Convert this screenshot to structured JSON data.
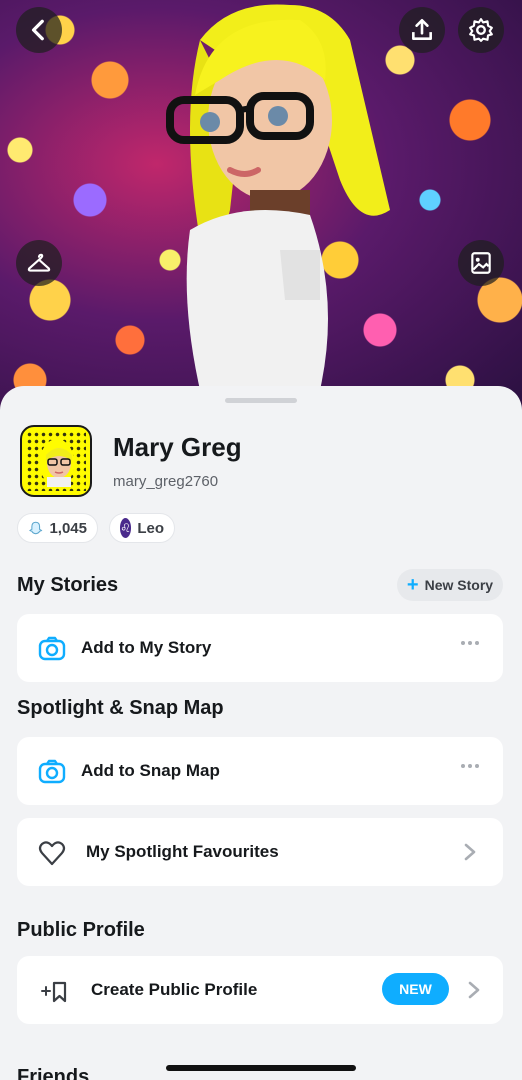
{
  "hero": {
    "back_icon": "chevron-left-icon",
    "share_icon": "upload-icon",
    "settings_icon": "gear-icon",
    "outfit_icon": "hanger-icon",
    "background_icon": "image-icon"
  },
  "profile": {
    "display_name": "Mary Greg",
    "username": "mary_greg2760",
    "score": "1,045",
    "zodiac_symbol": "♌",
    "zodiac": "Leo"
  },
  "my_stories": {
    "title": "My Stories",
    "new_story_label": "New Story",
    "add_label": "Add to My Story"
  },
  "spotlight": {
    "title": "Spotlight & Snap Map",
    "add_snap_map_label": "Add to Snap Map",
    "favourites_label": "My Spotlight Favourites"
  },
  "public_profile": {
    "title": "Public Profile",
    "create_label": "Create Public Profile",
    "badge": "NEW"
  },
  "friends": {
    "title": "Friends"
  },
  "colors": {
    "accent_blue": "#0FADFF",
    "snap_yellow": "#FFFC00",
    "zodiac_purple": "#4A2A8C"
  }
}
